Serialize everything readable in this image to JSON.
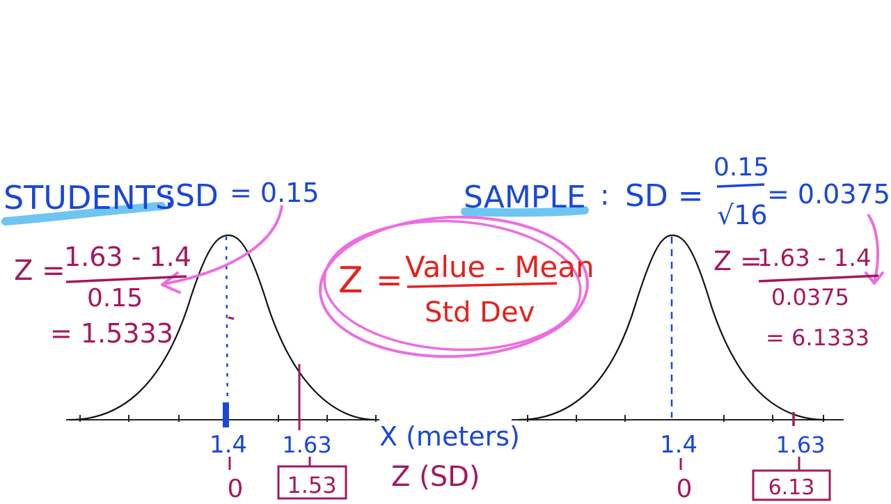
{
  "colors": {
    "blue": "#1847d8",
    "magenta": "#a3185e",
    "red": "#e3221c",
    "pink": "#ec6ee0",
    "highlight": "#6ec5f2",
    "curve": "#111111"
  },
  "formula": {
    "z": "Z",
    "equals": "=",
    "numerator": "Value - Mean",
    "denominator": "Std Dev"
  },
  "students": {
    "heading": "STUDENTS",
    "colon": ":",
    "sd_label": "SD",
    "sd_eq": "= 0.15",
    "work_line1_lhs": "Z =",
    "work_numerator": "1.63 - 1.4",
    "work_denominator": "0.15",
    "work_result": "= 1.5333",
    "mean_label": "1.4",
    "value_label": "1.63",
    "mean_z": "0",
    "value_z": "1.53"
  },
  "sample": {
    "heading": "SAMPLE",
    "colon": ":",
    "sd_label": "SD =",
    "sd_numerator": "0.15",
    "sd_denominator": "√16",
    "sd_result": "= 0.0375",
    "work_line1_lhs": "Z =",
    "work_numerator": "1.63 - 1.4",
    "work_denominator": "0.0375",
    "work_result": "= 6.1333",
    "mean_label": "1.4",
    "value_label": "1.63",
    "mean_z": "0",
    "value_z": "6.13"
  },
  "axis_labels": {
    "x": "X (meters)",
    "z": "Z (SD)"
  }
}
